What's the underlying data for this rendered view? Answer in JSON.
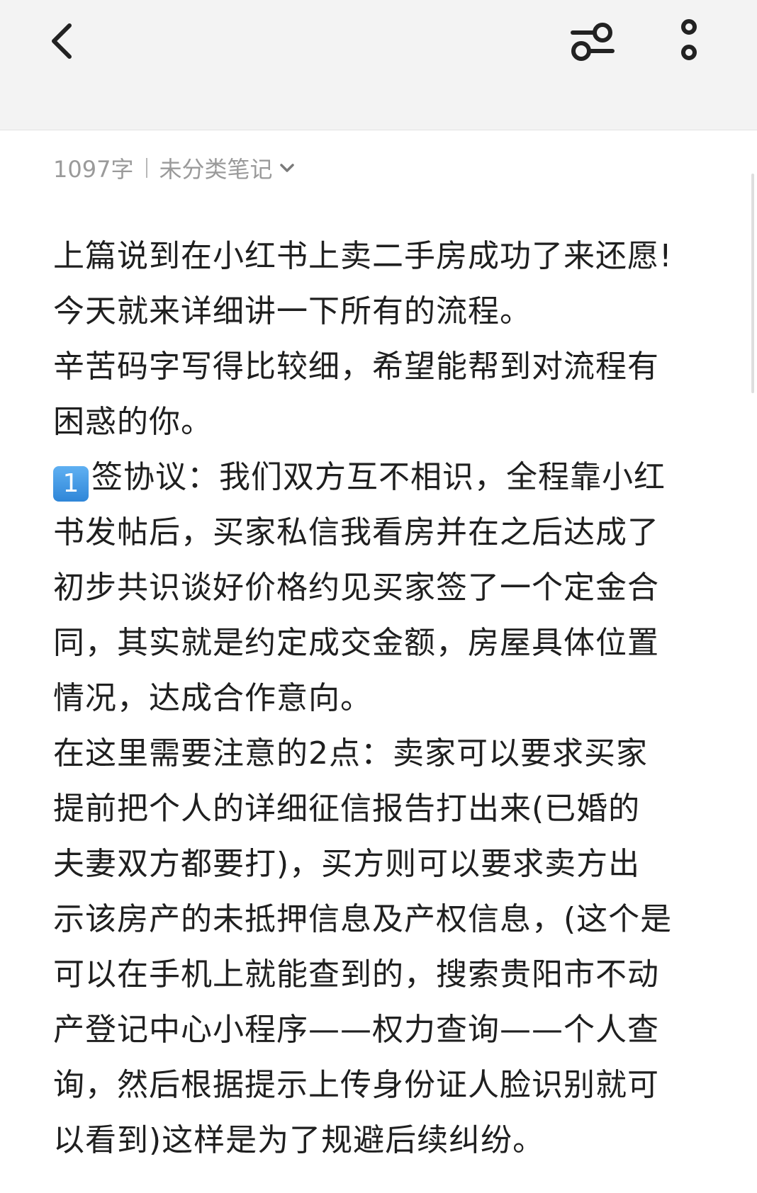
{
  "header": {
    "back_icon": "chevron-left-icon",
    "filter_icon": "sliders-icon",
    "more_icon": "vertical-dots-icon"
  },
  "meta": {
    "word_count": "1097字",
    "category": "未分类笔记",
    "category_icon": "chevron-down-icon"
  },
  "content": {
    "lines": [
      "上篇说到在小红书上卖二手房成功了来还愿!",
      "今天就来详细讲一下所有的流程。",
      "辛苦码字写得比较细，希望能帮到对流程有",
      "困惑的你。",
      "签协议：我们双方互不相识，全程靠小红",
      "书发帖后，买家私信我看房并在之后达成了",
      "初步共识谈好价格约见买家签了一个定金合",
      "同，其实就是约定成交金额，房屋具体位置",
      "情况，达成合作意向。",
      "在这里需要注意的2点：卖家可以要求买家",
      "提前把个人的详细征信报告打出来(已婚的",
      "夫妻双方都要打)，买方则可以要求卖方出",
      "示该房产的未抵押信息及产权信息，(这个是",
      "可以在手机上就能查到的，搜索贵阳市不动",
      "产登记中心小程序——权力查询——个人查",
      "询，然后根据提示上传身份证人脸识别就可",
      "以看到)这样是为了规避后续纠纷。"
    ],
    "keycap_number": "1",
    "keycap_icon": "keycap-one-emoji"
  }
}
